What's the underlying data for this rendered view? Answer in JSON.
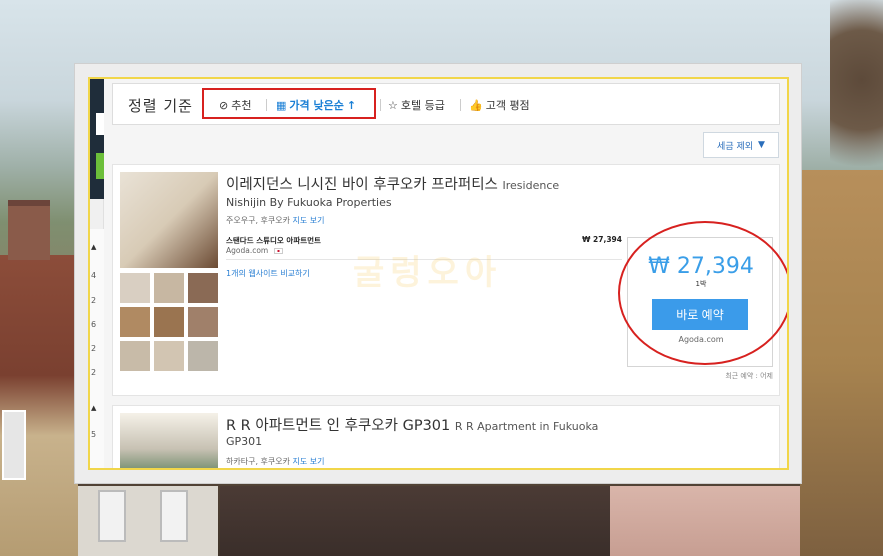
{
  "sort": {
    "title": "정렬 기준",
    "items": [
      {
        "label": "추천",
        "icon": "check-circle-icon"
      },
      {
        "label": "가격 낮은순",
        "icon": "building-icon",
        "arrow": "↑"
      },
      {
        "label": "호텔 등급",
        "icon": "star-icon"
      },
      {
        "label": "고객 평점",
        "icon": "thumbs-up-icon"
      }
    ]
  },
  "filter": {
    "label": "세금 제외",
    "caret": "▼"
  },
  "left_strip": {
    "numbers": [
      "4",
      "2",
      "6",
      "2",
      "2",
      "5"
    ],
    "arrows": [
      "▲",
      "▲"
    ]
  },
  "hotel1": {
    "name_ko": "이레지던스 니시진 바이 후쿠오카 프라퍼티스",
    "name_en": "Iresidence",
    "name_en2": "Nishijin By Fukuoka Properties",
    "location": "주오우구, 후쿠오카",
    "map_link": "지도 보기",
    "room": "스탠다드 스튜디오 아파트먼트",
    "room_price": "₩ 27,394",
    "room_site": "Agoda.com",
    "compare": "1개의 웹사이트 비교하기",
    "price": "₩ 27,394",
    "nights": "1박",
    "book": "바로 예약",
    "site": "Agoda.com",
    "recent": "최근 예약 : 어제"
  },
  "hotel2": {
    "name_ko": "R R 아파트먼트 인 후쿠오카 GP301",
    "name_en": "R R Apartment in Fukuoka",
    "sub": "GP301",
    "location": "하카타구, 후쿠오카",
    "map_link": "지도 보기"
  },
  "watermark": "굴렁오아",
  "colors": {
    "accent": "#3b9bea",
    "highlight": "#d7211f",
    "link": "#2a7fd3"
  }
}
